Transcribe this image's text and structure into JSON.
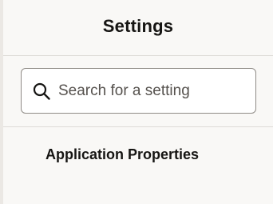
{
  "panel": {
    "title": "Settings"
  },
  "search": {
    "placeholder": "Search for a setting",
    "value": "",
    "icon": "search-icon"
  },
  "items": [
    {
      "label": "Application Properties"
    }
  ]
}
